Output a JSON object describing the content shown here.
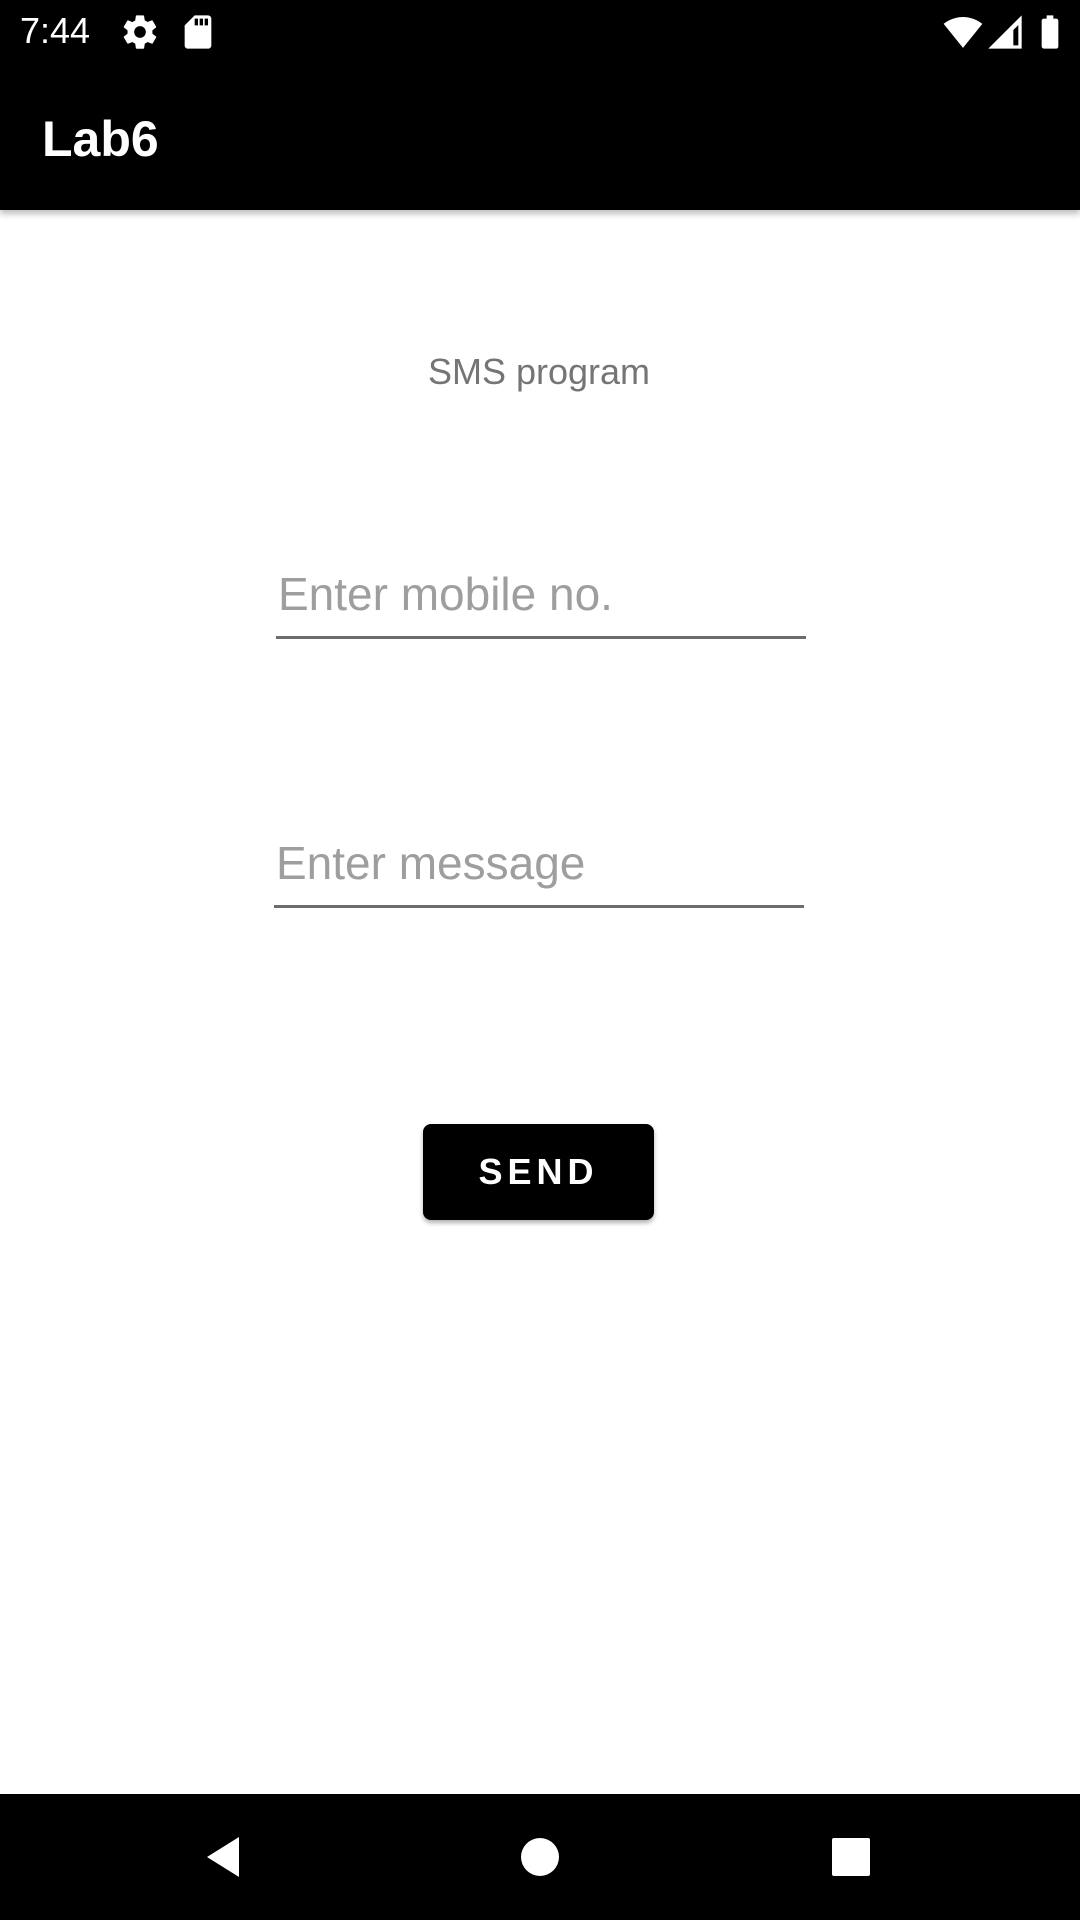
{
  "status_bar": {
    "time": "7:44",
    "icons": [
      "gear-icon",
      "sd-card-icon",
      "wifi-icon",
      "signal-icon",
      "battery-icon"
    ]
  },
  "app_bar": {
    "title": "Lab6"
  },
  "main": {
    "heading": "SMS program",
    "mobile_input": {
      "value": "",
      "placeholder": "Enter mobile no."
    },
    "message_input": {
      "value": "",
      "placeholder": "Enter message"
    },
    "send_label": "SEND"
  },
  "nav_bar": {
    "buttons": [
      "back-icon",
      "home-icon",
      "recents-icon"
    ]
  },
  "colors": {
    "bar_background": "#000000",
    "button_background": "#000000",
    "heading_text": "#757575",
    "placeholder_text": "#9e9e9e"
  }
}
